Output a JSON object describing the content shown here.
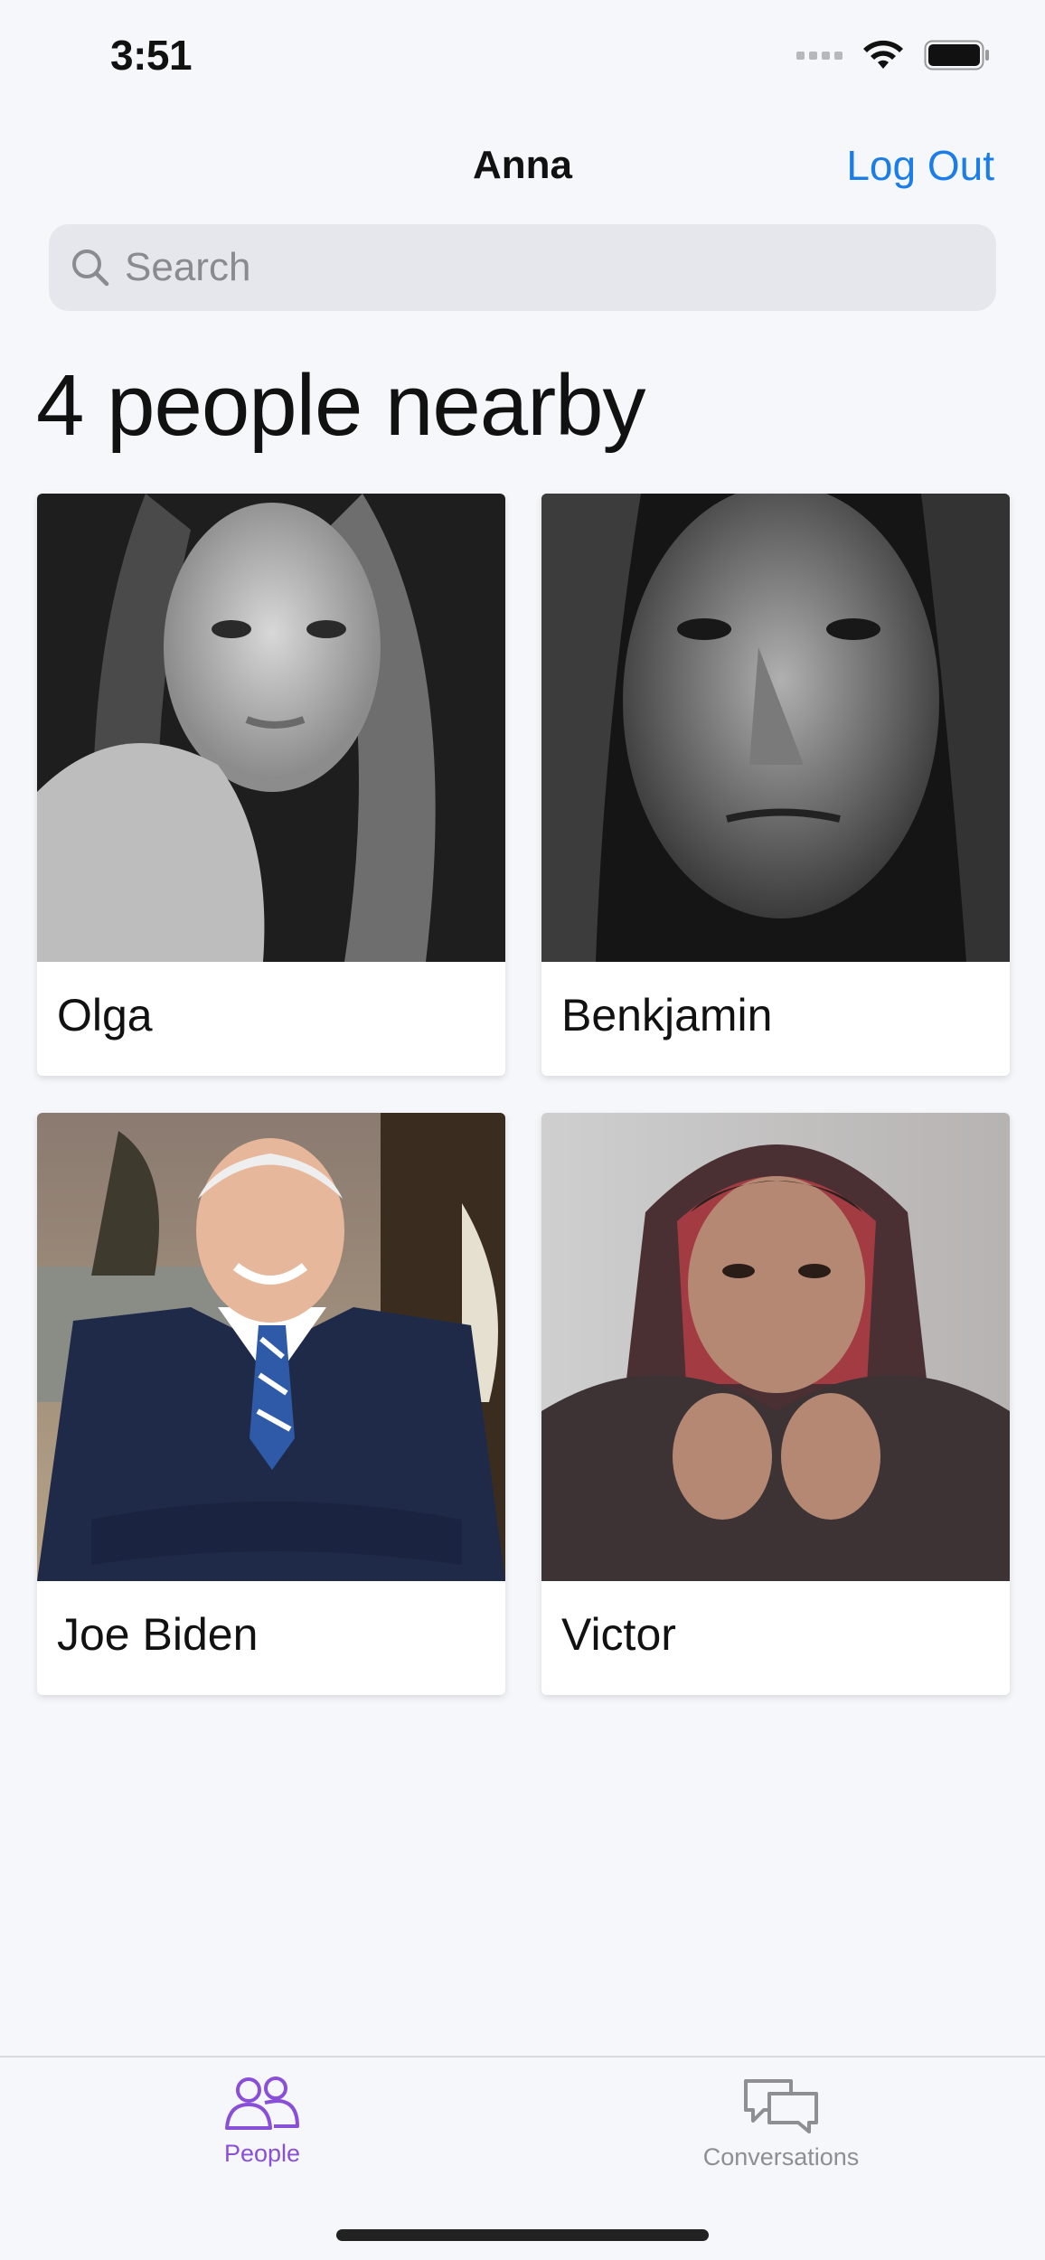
{
  "status_bar": {
    "time": "3:51"
  },
  "nav": {
    "title": "Anna",
    "logout_label": "Log Out"
  },
  "search": {
    "placeholder": "Search"
  },
  "heading": "4 people nearby",
  "people": [
    {
      "name": "Olga"
    },
    {
      "name": "Benkjamin"
    },
    {
      "name": "Joe Biden"
    },
    {
      "name": "Victor"
    }
  ],
  "tabs": [
    {
      "label": "People",
      "icon": "people-icon",
      "active": true,
      "color": "#8a4fd8"
    },
    {
      "label": "Conversations",
      "icon": "chat-bubbles-icon",
      "active": false,
      "color": "#8e8e93"
    }
  ],
  "colors": {
    "accent": "#1a7de8",
    "tab_active": "#8a4fd8",
    "background": "#f6f7fb"
  }
}
